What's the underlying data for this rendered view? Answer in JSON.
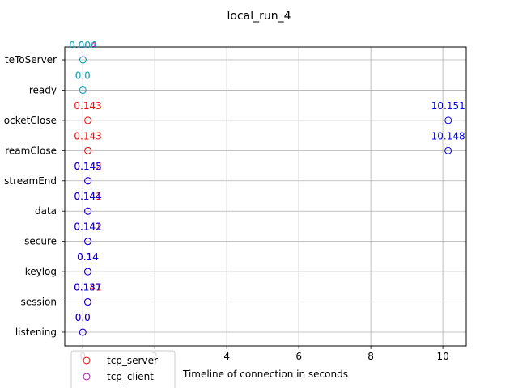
{
  "chart_data": {
    "type": "scatter",
    "title": "local_run_4",
    "xlabel": "Timeline of connection in seconds",
    "ylabel": "",
    "xlim": [
      -0.5,
      10.65
    ],
    "x_ticks": [
      0,
      2,
      4,
      6,
      8,
      10
    ],
    "x_tick_labels": [
      "0",
      "2",
      "4",
      "6",
      "8",
      "10"
    ],
    "categories": [
      "listening",
      "session",
      "keylog",
      "secure",
      "data",
      "streamEnd",
      "streamClose",
      "socketClose",
      "ready",
      "writeToServer"
    ],
    "category_labels_visible": [
      "listening",
      "session",
      "keylog",
      "secure",
      "data",
      "streamEnd",
      "reamClose",
      "ocketClose",
      "ready",
      "teToServer"
    ],
    "grid": true,
    "legend_position": "lower-left",
    "series": [
      {
        "name": "tcp_server",
        "color": "#ff0000",
        "points": [
          {
            "category": "listening",
            "x": 0.0,
            "label": "0.0"
          },
          {
            "category": "session",
            "x": 0.141,
            "label": "0.141"
          },
          {
            "category": "keylog",
            "x": 0.14,
            "label": "0.14"
          },
          {
            "category": "secure",
            "x": 0.141,
            "label": "0.141"
          },
          {
            "category": "data",
            "x": 0.141,
            "label": "0.141"
          },
          {
            "category": "streamEnd",
            "x": 0.142,
            "label": "0.142"
          },
          {
            "category": "streamClose",
            "x": 0.143,
            "label": "0.143"
          },
          {
            "category": "socketClose",
            "x": 0.143,
            "label": "0.143"
          }
        ]
      },
      {
        "name": "tcp_client",
        "color": "#bf00bf",
        "points": [
          {
            "category": "ready",
            "x": 0.0,
            "label": "0.0"
          },
          {
            "category": "writeToServer",
            "x": 0.004,
            "label": "0.004"
          }
        ]
      },
      {
        "name": "",
        "color": "#0000ff",
        "points": [
          {
            "category": "listening",
            "x": 0.0,
            "label": "0.0"
          },
          {
            "category": "session",
            "x": 0.137,
            "label": "0.137"
          },
          {
            "category": "keylog",
            "x": 0.14,
            "label": "0.14"
          },
          {
            "category": "secure",
            "x": 0.142,
            "label": "0.142"
          },
          {
            "category": "data",
            "x": 0.144,
            "label": "0.144"
          },
          {
            "category": "streamEnd",
            "x": 0.145,
            "label": "0.145"
          },
          {
            "category": "streamClose",
            "x": 10.148,
            "label": "10.148"
          },
          {
            "category": "socketClose",
            "x": 10.151,
            "label": "10.151"
          }
        ]
      },
      {
        "name": "",
        "color": "#00bfbf",
        "points": [
          {
            "category": "ready",
            "x": 0.0,
            "label": "0.0"
          },
          {
            "category": "writeToServer",
            "x": 0.006,
            "label": "0.006"
          }
        ]
      }
    ],
    "legend": [
      {
        "label": "tcp_server",
        "color": "#ff0000"
      },
      {
        "label": "tcp_client",
        "color": "#bf00bf"
      }
    ]
  }
}
